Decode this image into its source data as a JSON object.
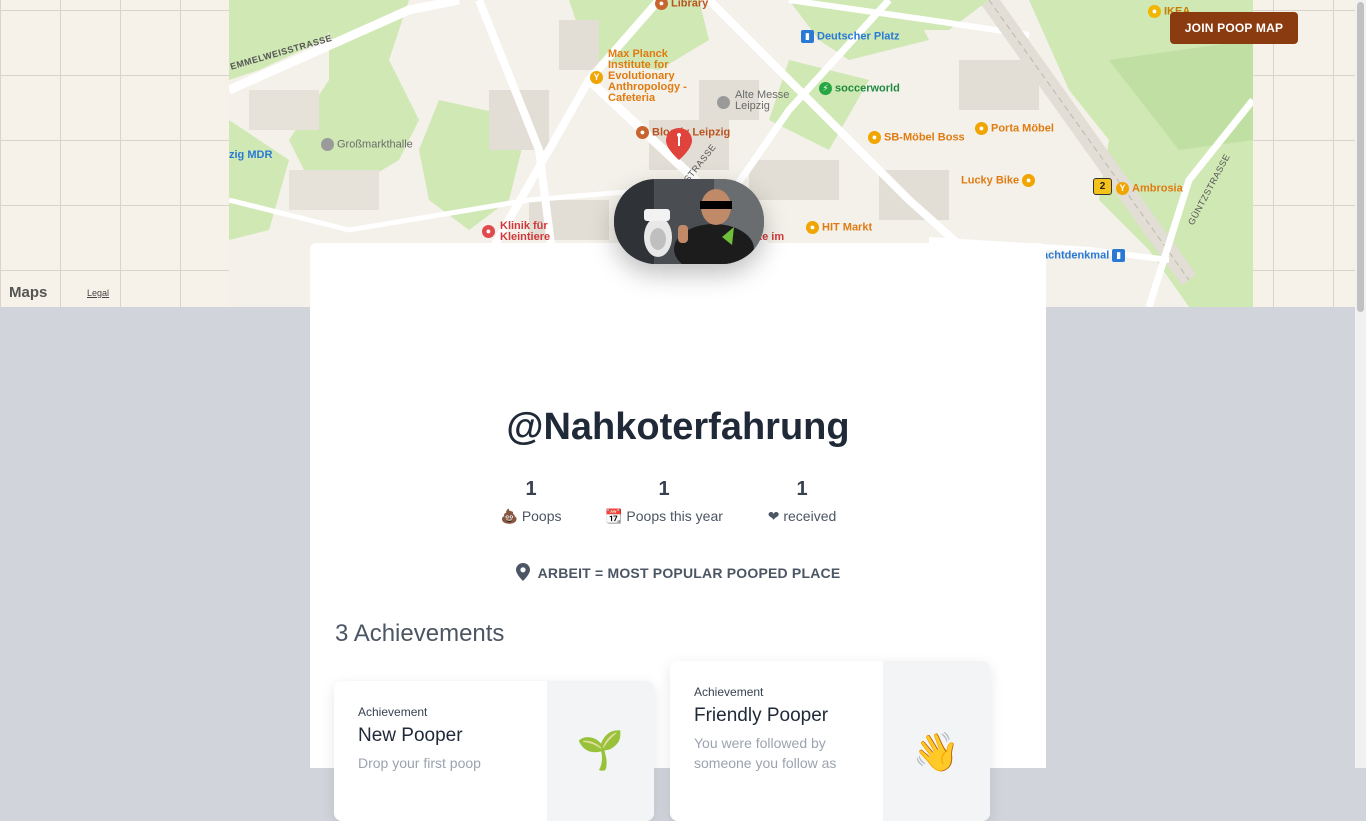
{
  "map": {
    "brand": "Maps",
    "legal": "Legal",
    "streets": [
      "EMMELWEISSTRASSE",
      "STRASSE",
      "GÜNTZSTRASSE"
    ],
    "pois": [
      {
        "label": "Library",
        "color": "brown"
      },
      {
        "label": "Max Planck Institute for Evolutionary Anthropology - Cafeteria",
        "color": "orange"
      },
      {
        "label": "Alte Messe Leipzig",
        "color": "gray"
      },
      {
        "label": "Deutscher Platz",
        "color": "blue"
      },
      {
        "label": "soccerworld",
        "color": "green"
      },
      {
        "label": "Bloody Leipzig",
        "color": "brown"
      },
      {
        "label": "Großmarkthalle",
        "color": "gray"
      },
      {
        "label": "zig MDR",
        "color": "blue"
      },
      {
        "label": "SB-Möbel Boss",
        "color": "orange"
      },
      {
        "label": "Porta Möbel",
        "color": "orange"
      },
      {
        "label": "Lucky Bike",
        "color": "orange"
      },
      {
        "label": "Ambrosia",
        "color": "orange"
      },
      {
        "label": "HIT Markt",
        "color": "orange"
      },
      {
        "label": "Klinik für Kleintiere",
        "color": "red"
      },
      {
        "label": "IKEA",
        "color": "yellow"
      },
      {
        "label": "achtdenkmal",
        "color": "blue"
      },
      {
        "label": "ke im",
        "color": "red"
      }
    ],
    "badge": "2"
  },
  "header": {
    "join_button": "JOIN POOP MAP"
  },
  "profile": {
    "username": "@Nahkoterfahrung",
    "stats": [
      {
        "value": "1",
        "icon": "💩",
        "label": "Poops"
      },
      {
        "value": "1",
        "icon": "📆",
        "label": "Poops this year"
      },
      {
        "value": "1",
        "icon": "❤",
        "label": "received"
      }
    ],
    "popular_place": "ARBEIT = MOST POPULAR POOPED PLACE"
  },
  "achievements": {
    "title": "3 Achievements",
    "items": [
      {
        "kind": "Achievement",
        "name": "New Pooper",
        "description": "Drop your first poop",
        "emoji": "🌱"
      },
      {
        "kind": "Achievement",
        "name": "Friendly Pooper",
        "description": "You were followed by someone you follow as",
        "emoji": "👋"
      }
    ]
  }
}
